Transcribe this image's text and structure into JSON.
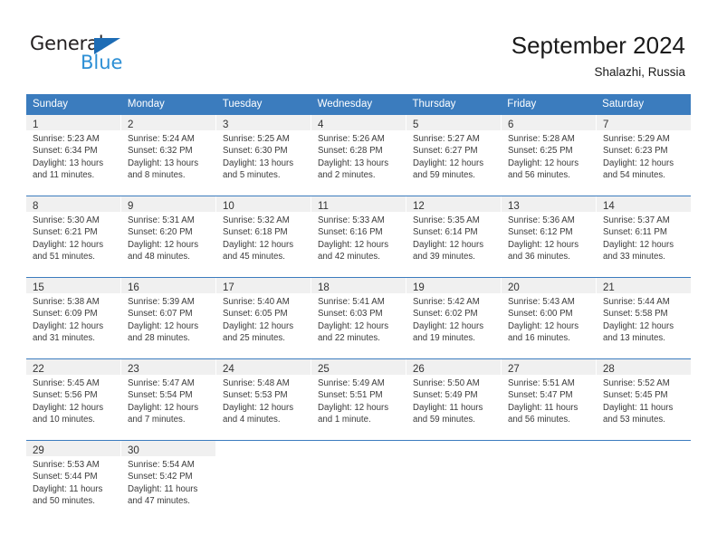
{
  "brand": {
    "name_top": "General",
    "name_bottom": "Blue",
    "accent_color": "#1d6cb5",
    "accent_color_light": "#2d8fd5"
  },
  "header": {
    "title": "September 2024",
    "subtitle": "Shalazhi, Russia"
  },
  "calendar": {
    "header_bg": "#3b7cbe",
    "daynum_bg": "#f0f0f0",
    "weekdays": [
      "Sunday",
      "Monday",
      "Tuesday",
      "Wednesday",
      "Thursday",
      "Friday",
      "Saturday"
    ],
    "weeks": [
      [
        {
          "day": "1",
          "sunrise": "Sunrise: 5:23 AM",
          "sunset": "Sunset: 6:34 PM",
          "daylight1": "Daylight: 13 hours",
          "daylight2": "and 11 minutes."
        },
        {
          "day": "2",
          "sunrise": "Sunrise: 5:24 AM",
          "sunset": "Sunset: 6:32 PM",
          "daylight1": "Daylight: 13 hours",
          "daylight2": "and 8 minutes."
        },
        {
          "day": "3",
          "sunrise": "Sunrise: 5:25 AM",
          "sunset": "Sunset: 6:30 PM",
          "daylight1": "Daylight: 13 hours",
          "daylight2": "and 5 minutes."
        },
        {
          "day": "4",
          "sunrise": "Sunrise: 5:26 AM",
          "sunset": "Sunset: 6:28 PM",
          "daylight1": "Daylight: 13 hours",
          "daylight2": "and 2 minutes."
        },
        {
          "day": "5",
          "sunrise": "Sunrise: 5:27 AM",
          "sunset": "Sunset: 6:27 PM",
          "daylight1": "Daylight: 12 hours",
          "daylight2": "and 59 minutes."
        },
        {
          "day": "6",
          "sunrise": "Sunrise: 5:28 AM",
          "sunset": "Sunset: 6:25 PM",
          "daylight1": "Daylight: 12 hours",
          "daylight2": "and 56 minutes."
        },
        {
          "day": "7",
          "sunrise": "Sunrise: 5:29 AM",
          "sunset": "Sunset: 6:23 PM",
          "daylight1": "Daylight: 12 hours",
          "daylight2": "and 54 minutes."
        }
      ],
      [
        {
          "day": "8",
          "sunrise": "Sunrise: 5:30 AM",
          "sunset": "Sunset: 6:21 PM",
          "daylight1": "Daylight: 12 hours",
          "daylight2": "and 51 minutes."
        },
        {
          "day": "9",
          "sunrise": "Sunrise: 5:31 AM",
          "sunset": "Sunset: 6:20 PM",
          "daylight1": "Daylight: 12 hours",
          "daylight2": "and 48 minutes."
        },
        {
          "day": "10",
          "sunrise": "Sunrise: 5:32 AM",
          "sunset": "Sunset: 6:18 PM",
          "daylight1": "Daylight: 12 hours",
          "daylight2": "and 45 minutes."
        },
        {
          "day": "11",
          "sunrise": "Sunrise: 5:33 AM",
          "sunset": "Sunset: 6:16 PM",
          "daylight1": "Daylight: 12 hours",
          "daylight2": "and 42 minutes."
        },
        {
          "day": "12",
          "sunrise": "Sunrise: 5:35 AM",
          "sunset": "Sunset: 6:14 PM",
          "daylight1": "Daylight: 12 hours",
          "daylight2": "and 39 minutes."
        },
        {
          "day": "13",
          "sunrise": "Sunrise: 5:36 AM",
          "sunset": "Sunset: 6:12 PM",
          "daylight1": "Daylight: 12 hours",
          "daylight2": "and 36 minutes."
        },
        {
          "day": "14",
          "sunrise": "Sunrise: 5:37 AM",
          "sunset": "Sunset: 6:11 PM",
          "daylight1": "Daylight: 12 hours",
          "daylight2": "and 33 minutes."
        }
      ],
      [
        {
          "day": "15",
          "sunrise": "Sunrise: 5:38 AM",
          "sunset": "Sunset: 6:09 PM",
          "daylight1": "Daylight: 12 hours",
          "daylight2": "and 31 minutes."
        },
        {
          "day": "16",
          "sunrise": "Sunrise: 5:39 AM",
          "sunset": "Sunset: 6:07 PM",
          "daylight1": "Daylight: 12 hours",
          "daylight2": "and 28 minutes."
        },
        {
          "day": "17",
          "sunrise": "Sunrise: 5:40 AM",
          "sunset": "Sunset: 6:05 PM",
          "daylight1": "Daylight: 12 hours",
          "daylight2": "and 25 minutes."
        },
        {
          "day": "18",
          "sunrise": "Sunrise: 5:41 AM",
          "sunset": "Sunset: 6:03 PM",
          "daylight1": "Daylight: 12 hours",
          "daylight2": "and 22 minutes."
        },
        {
          "day": "19",
          "sunrise": "Sunrise: 5:42 AM",
          "sunset": "Sunset: 6:02 PM",
          "daylight1": "Daylight: 12 hours",
          "daylight2": "and 19 minutes."
        },
        {
          "day": "20",
          "sunrise": "Sunrise: 5:43 AM",
          "sunset": "Sunset: 6:00 PM",
          "daylight1": "Daylight: 12 hours",
          "daylight2": "and 16 minutes."
        },
        {
          "day": "21",
          "sunrise": "Sunrise: 5:44 AM",
          "sunset": "Sunset: 5:58 PM",
          "daylight1": "Daylight: 12 hours",
          "daylight2": "and 13 minutes."
        }
      ],
      [
        {
          "day": "22",
          "sunrise": "Sunrise: 5:45 AM",
          "sunset": "Sunset: 5:56 PM",
          "daylight1": "Daylight: 12 hours",
          "daylight2": "and 10 minutes."
        },
        {
          "day": "23",
          "sunrise": "Sunrise: 5:47 AM",
          "sunset": "Sunset: 5:54 PM",
          "daylight1": "Daylight: 12 hours",
          "daylight2": "and 7 minutes."
        },
        {
          "day": "24",
          "sunrise": "Sunrise: 5:48 AM",
          "sunset": "Sunset: 5:53 PM",
          "daylight1": "Daylight: 12 hours",
          "daylight2": "and 4 minutes."
        },
        {
          "day": "25",
          "sunrise": "Sunrise: 5:49 AM",
          "sunset": "Sunset: 5:51 PM",
          "daylight1": "Daylight: 12 hours",
          "daylight2": "and 1 minute."
        },
        {
          "day": "26",
          "sunrise": "Sunrise: 5:50 AM",
          "sunset": "Sunset: 5:49 PM",
          "daylight1": "Daylight: 11 hours",
          "daylight2": "and 59 minutes."
        },
        {
          "day": "27",
          "sunrise": "Sunrise: 5:51 AM",
          "sunset": "Sunset: 5:47 PM",
          "daylight1": "Daylight: 11 hours",
          "daylight2": "and 56 minutes."
        },
        {
          "day": "28",
          "sunrise": "Sunrise: 5:52 AM",
          "sunset": "Sunset: 5:45 PM",
          "daylight1": "Daylight: 11 hours",
          "daylight2": "and 53 minutes."
        }
      ],
      [
        {
          "day": "29",
          "sunrise": "Sunrise: 5:53 AM",
          "sunset": "Sunset: 5:44 PM",
          "daylight1": "Daylight: 11 hours",
          "daylight2": "and 50 minutes."
        },
        {
          "day": "30",
          "sunrise": "Sunrise: 5:54 AM",
          "sunset": "Sunset: 5:42 PM",
          "daylight1": "Daylight: 11 hours",
          "daylight2": "and 47 minutes."
        },
        {
          "day": "",
          "sunrise": "",
          "sunset": "",
          "daylight1": "",
          "daylight2": ""
        },
        {
          "day": "",
          "sunrise": "",
          "sunset": "",
          "daylight1": "",
          "daylight2": ""
        },
        {
          "day": "",
          "sunrise": "",
          "sunset": "",
          "daylight1": "",
          "daylight2": ""
        },
        {
          "day": "",
          "sunrise": "",
          "sunset": "",
          "daylight1": "",
          "daylight2": ""
        },
        {
          "day": "",
          "sunrise": "",
          "sunset": "",
          "daylight1": "",
          "daylight2": ""
        }
      ]
    ]
  }
}
